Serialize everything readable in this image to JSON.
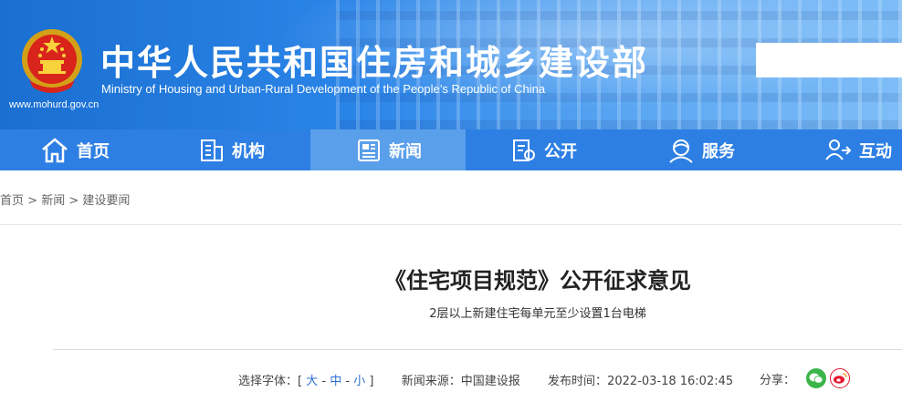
{
  "header": {
    "title_cn": "中华人民共和国住房和城乡建设部",
    "title_en": "Ministry of Housing and Urban-Rural Development of the People’s Republic of China",
    "url": "www.mohurd.gov.cn",
    "emblem_icon": "national-emblem-icon",
    "search_value": ""
  },
  "nav": {
    "items": [
      {
        "label": "首页",
        "icon": "home-icon"
      },
      {
        "label": "机构",
        "icon": "building-icon"
      },
      {
        "label": "新闻",
        "icon": "news-icon"
      },
      {
        "label": "公开",
        "icon": "disclosure-icon"
      },
      {
        "label": "服务",
        "icon": "service-icon"
      },
      {
        "label": "互动",
        "icon": "interaction-icon"
      }
    ],
    "active_index": 2
  },
  "breadcrumb": {
    "items": [
      "首页",
      "新闻",
      "建设要闻"
    ],
    "separator": ">"
  },
  "article": {
    "title": "《住宅项目规范》公开征求意见",
    "subtitle": "2层以上新建住宅每单元至少设置1台电梯",
    "font_size_label": "选择字体：[",
    "font_large": "大",
    "font_medium": "中",
    "font_small": "小",
    "font_close": "]",
    "font_dash": "-",
    "source_label": "新闻来源：",
    "source": "中国建设报",
    "time_label": "发布时间：",
    "time": "2022-03-18 16:02:45",
    "share_label": "分享："
  },
  "colors": {
    "nav_bg": "#2d7fe3",
    "nav_active": "#5a9fea",
    "wechat": "#3bb54a",
    "weibo": "#e6162d"
  }
}
